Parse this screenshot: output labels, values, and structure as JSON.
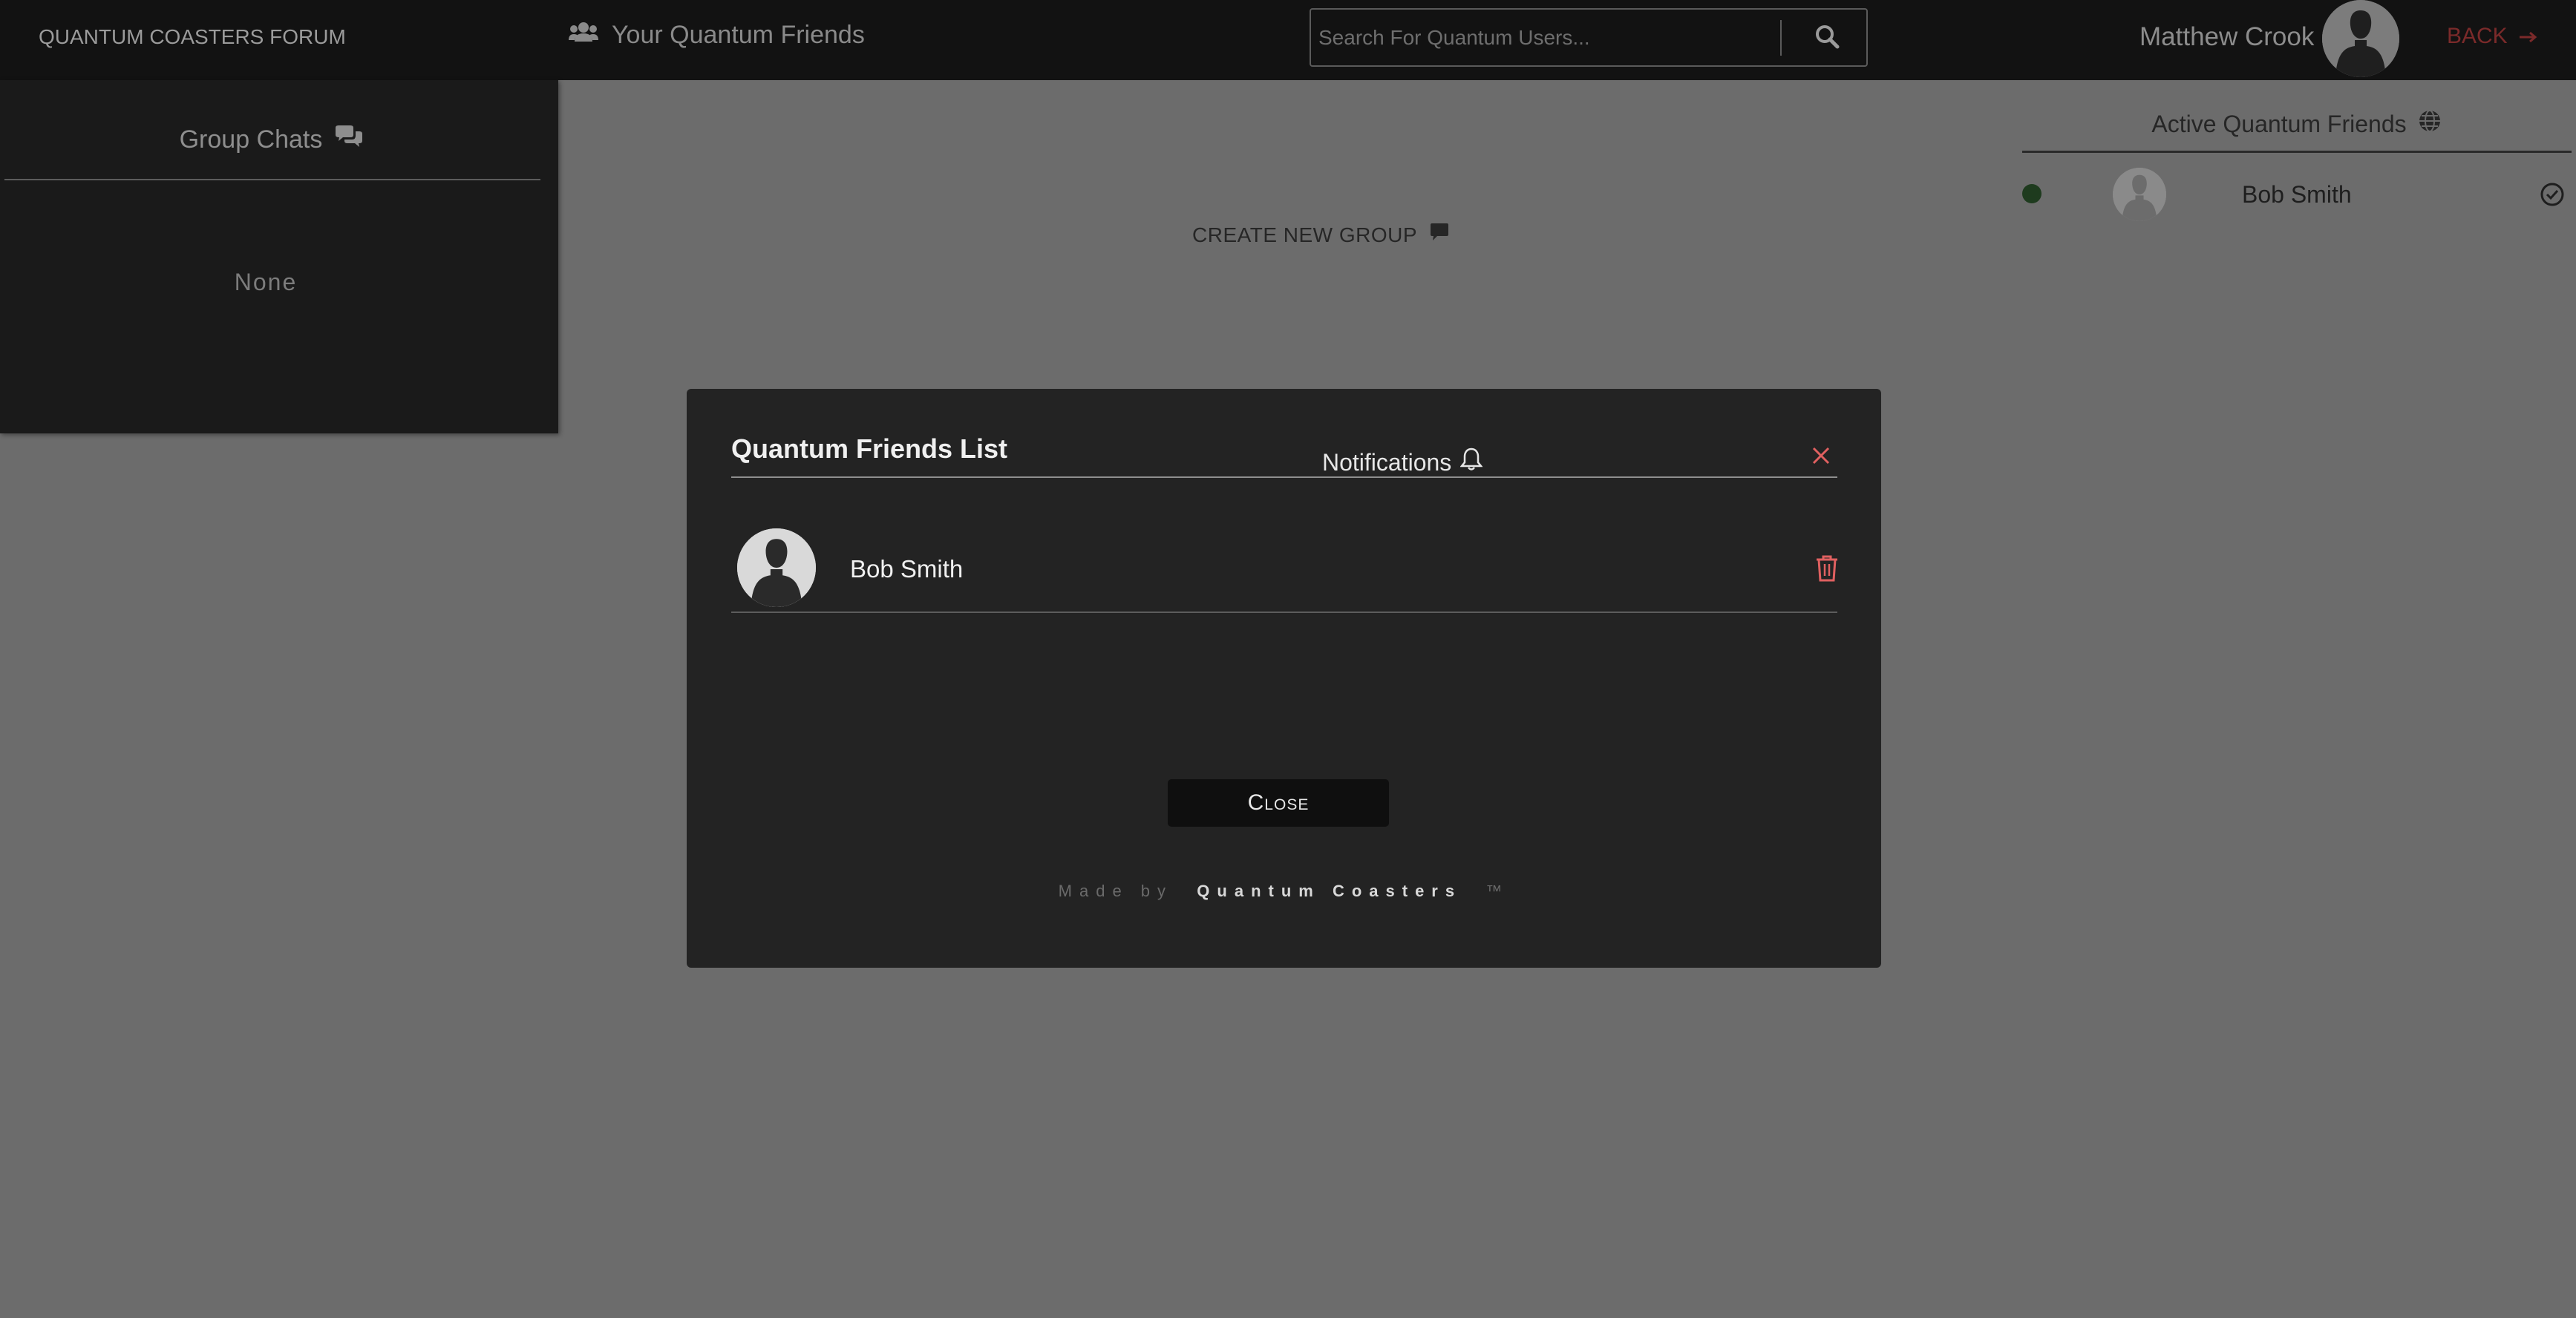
{
  "header": {
    "brand": "QUANTUM COASTERS FORUM",
    "friends_link": "Your Quantum Friends",
    "search_placeholder": "Search For Quantum Users...",
    "username": "Matthew Crook",
    "back_label": "BACK"
  },
  "sidebar": {
    "title": "Group Chats",
    "empty_text": "None"
  },
  "main": {
    "create_group_label": "CREATE NEW GROUP"
  },
  "active_friends": {
    "title": "Active Quantum Friends",
    "items": [
      {
        "name": "Bob Smith",
        "status_color": "#1e3b1e"
      }
    ]
  },
  "modal": {
    "title": "Quantum Friends List",
    "notifications_label": "Notifications",
    "friends": [
      {
        "name": "Bob Smith"
      }
    ],
    "close_label": "Close",
    "footer_prefix": "Made by",
    "footer_brand": "Quantum Coasters",
    "footer_tm": "™"
  },
  "colors": {
    "accent_red": "#e06060",
    "back_red": "#7b2a2a",
    "online_green": "#1e3b1e"
  }
}
